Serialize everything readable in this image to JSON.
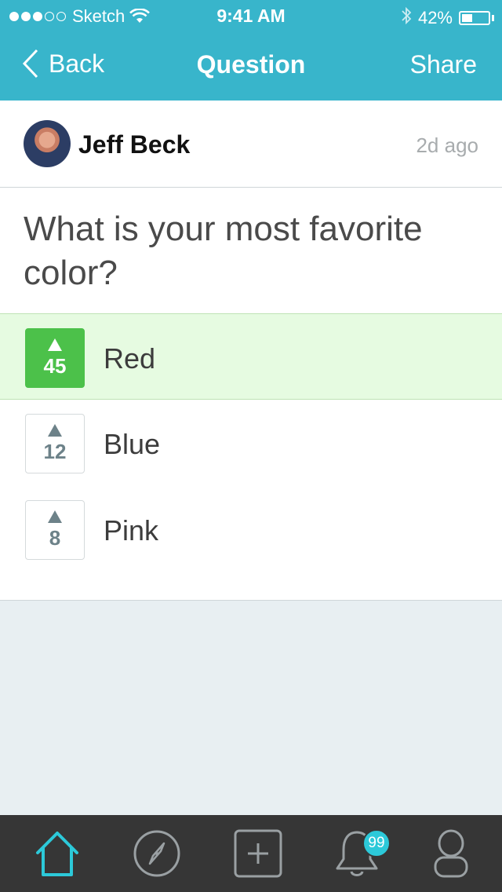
{
  "status_bar": {
    "carrier": "Sketch",
    "time": "9:41 AM",
    "battery_percent": "42%",
    "battery_level": 0.42,
    "signal_bars_filled": 3,
    "signal_bars_total": 5
  },
  "nav": {
    "back_label": "Back",
    "title": "Question",
    "share_label": "Share"
  },
  "post": {
    "author": "Jeff Beck",
    "time_ago": "2d ago",
    "question": "What is your most favorite color?"
  },
  "answers": [
    {
      "label": "Red",
      "votes": "45",
      "selected": true
    },
    {
      "label": "Blue",
      "votes": "12",
      "selected": false
    },
    {
      "label": "Pink",
      "votes": "8",
      "selected": false
    }
  ],
  "tab_bar": {
    "tabs": [
      {
        "icon": "home-icon",
        "active": true
      },
      {
        "icon": "compass-icon",
        "active": false
      },
      {
        "icon": "add-icon",
        "active": false
      },
      {
        "icon": "bell-icon",
        "active": false,
        "badge": "99"
      },
      {
        "icon": "profile-icon",
        "active": false
      }
    ]
  },
  "colors": {
    "accent": "#38b5cb",
    "selected_bg": "#e6fbe1",
    "vote_green": "#4cc14a",
    "tab_bar_bg": "#363636",
    "badge": "#2cc9d9"
  }
}
